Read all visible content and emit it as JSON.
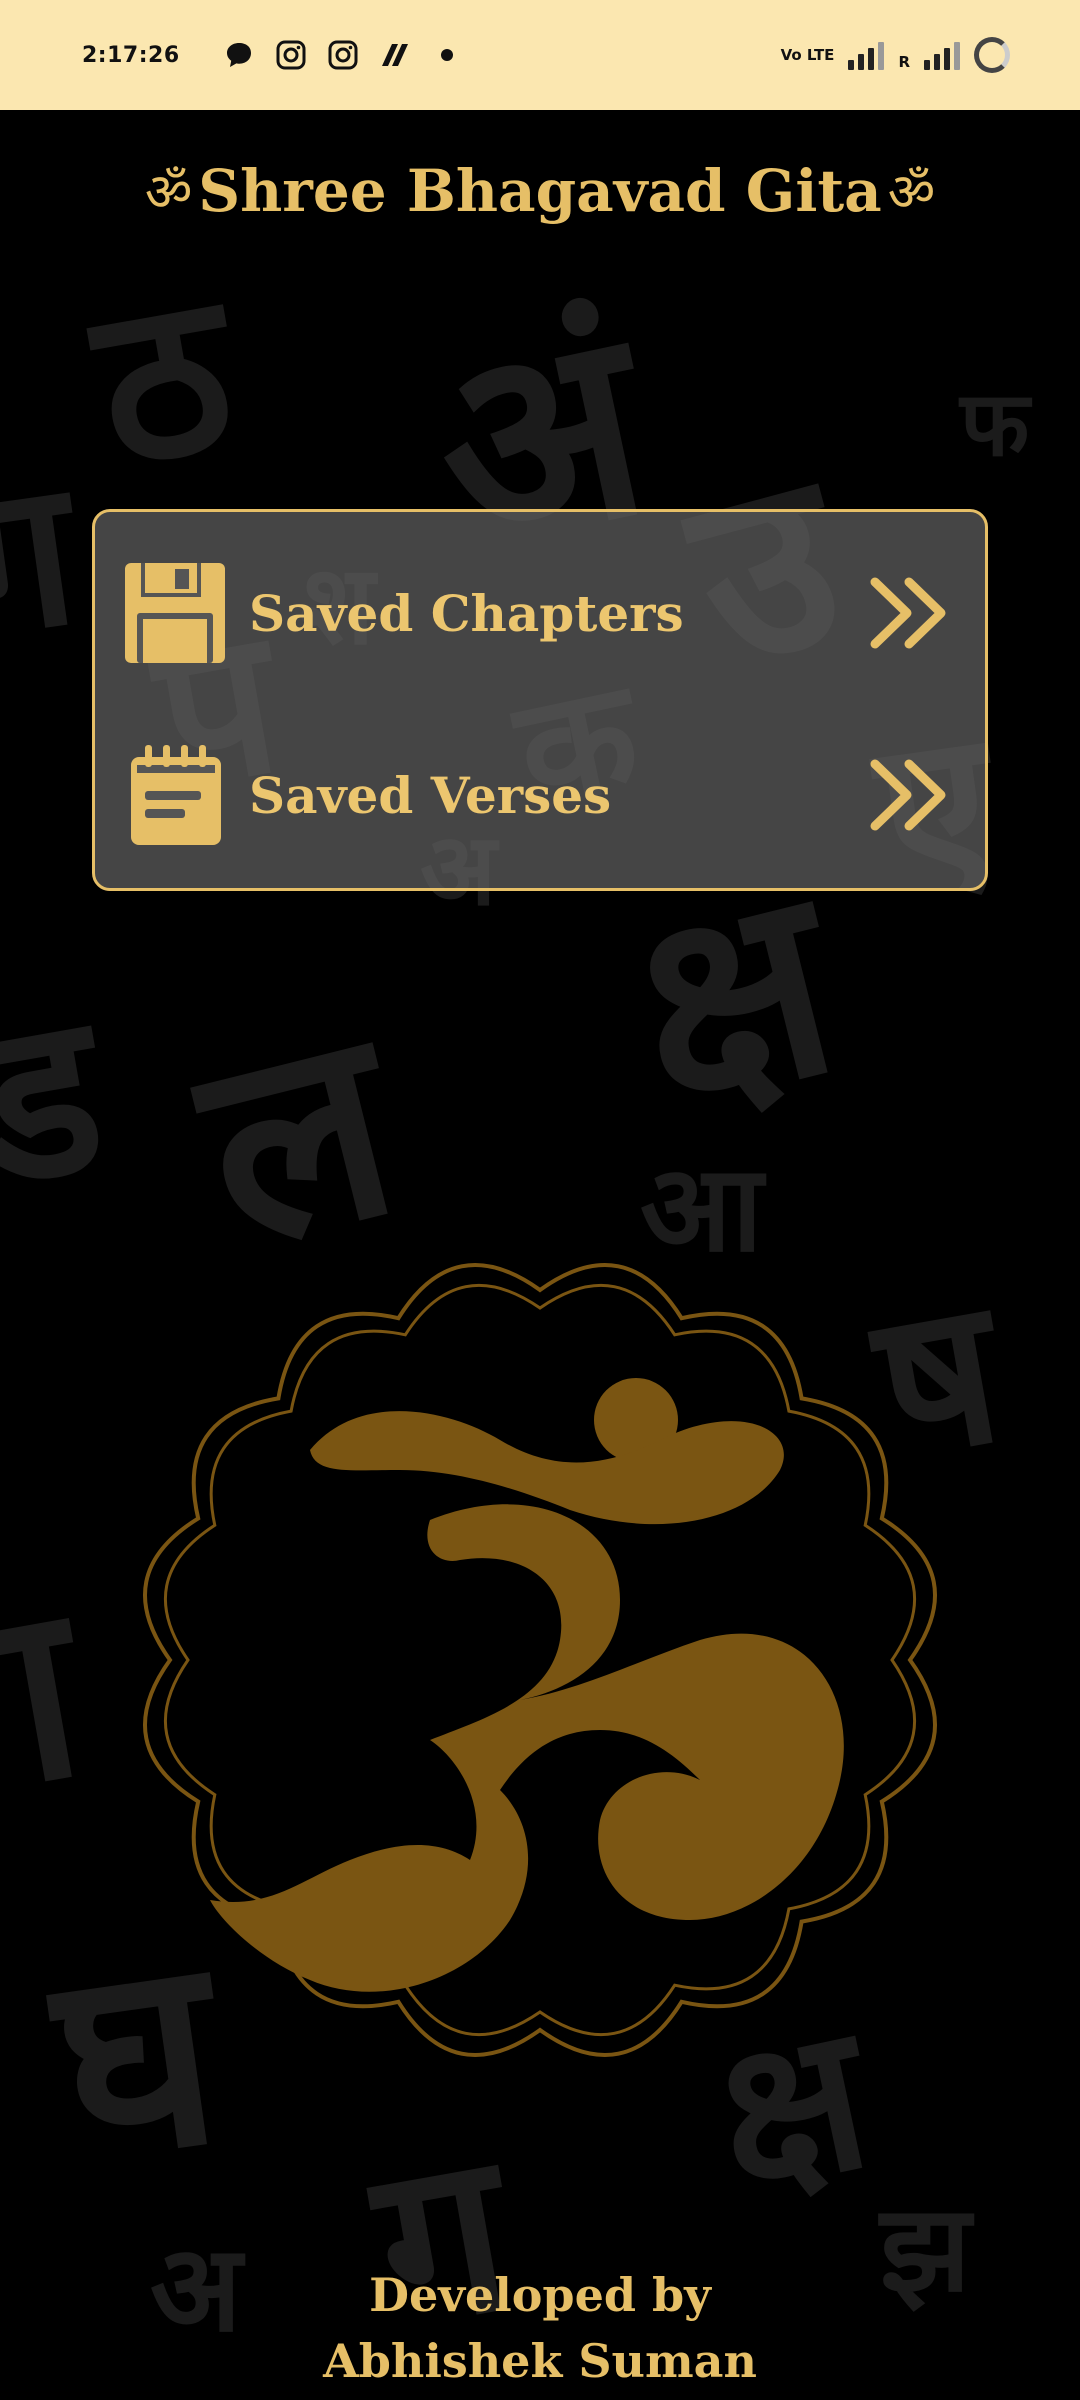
{
  "status_bar": {
    "time": "2:17:26",
    "left_icons": [
      "chat-bubble-icon",
      "instagram-icon",
      "instagram-icon",
      "app-logo-icon",
      "dot-icon"
    ],
    "network_label": "Vo LTE",
    "roaming_label": "R"
  },
  "header": {
    "title": "Shree Bhagavad Gita",
    "om_symbol": "ॐ"
  },
  "saved_menu": {
    "items": [
      {
        "label": "Saved Chapters",
        "icon": "floppy-disk-icon",
        "arrow": "double-chevron-right-icon"
      },
      {
        "label": "Saved Verses",
        "icon": "notepad-icon",
        "arrow": "double-chevron-right-icon"
      }
    ]
  },
  "emblem": {
    "symbol": "om-icon"
  },
  "footer": {
    "line1": "Developed by",
    "line2": "Abhishek Suman"
  },
  "colors": {
    "accent_gold": "#e6bf67",
    "om_gold": "#7a5512",
    "status_bar_bg": "#fbe7b0",
    "background": "#000000",
    "card_bg": "#5f5f5f"
  }
}
